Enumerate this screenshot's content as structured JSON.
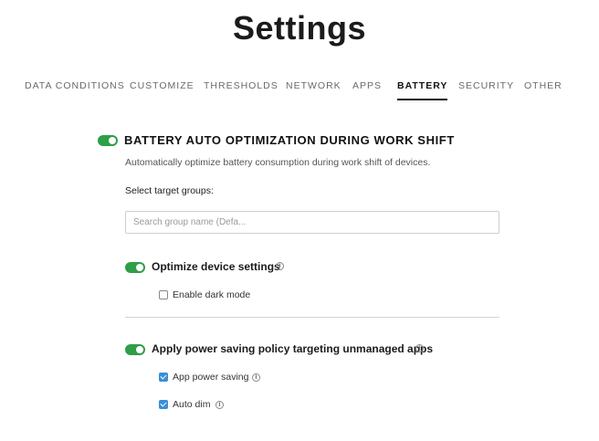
{
  "page": {
    "title": "Settings"
  },
  "tabs": [
    {
      "label": "DATA CONDITIONS",
      "active": false
    },
    {
      "label": "CUSTOMIZE",
      "active": false
    },
    {
      "label": "THRESHOLDS",
      "active": false
    },
    {
      "label": "NETWORK",
      "active": false
    },
    {
      "label": "APPS",
      "active": false
    },
    {
      "label": "BATTERY",
      "active": true
    },
    {
      "label": "SECURITY",
      "active": false
    },
    {
      "label": "OTHER",
      "active": false
    }
  ],
  "battery": {
    "title": "BATTERY AUTO OPTIMIZATION DURING WORK SHIFT",
    "enabled": true,
    "description": "Automatically optimize battery consumption during work shift of devices.",
    "target_groups_label": "Select target groups:",
    "search_placeholder": "Search group name (Defa...",
    "search_value": "",
    "optimize_device": {
      "title": "Optimize device settings",
      "enabled": true,
      "options": [
        {
          "label": "Enable dark mode",
          "checked": false
        }
      ]
    },
    "power_saving": {
      "title": "Apply power saving policy targeting unmanaged apps",
      "enabled": true,
      "options": [
        {
          "label": "App power saving",
          "checked": true
        },
        {
          "label": "Auto dim",
          "checked": true
        }
      ]
    }
  },
  "colors": {
    "toggle_on": "#2e9e47",
    "checkbox_checked": "#3a8fd6",
    "active_tab": "#111111"
  },
  "icons": {
    "info": "info-circle-icon"
  }
}
